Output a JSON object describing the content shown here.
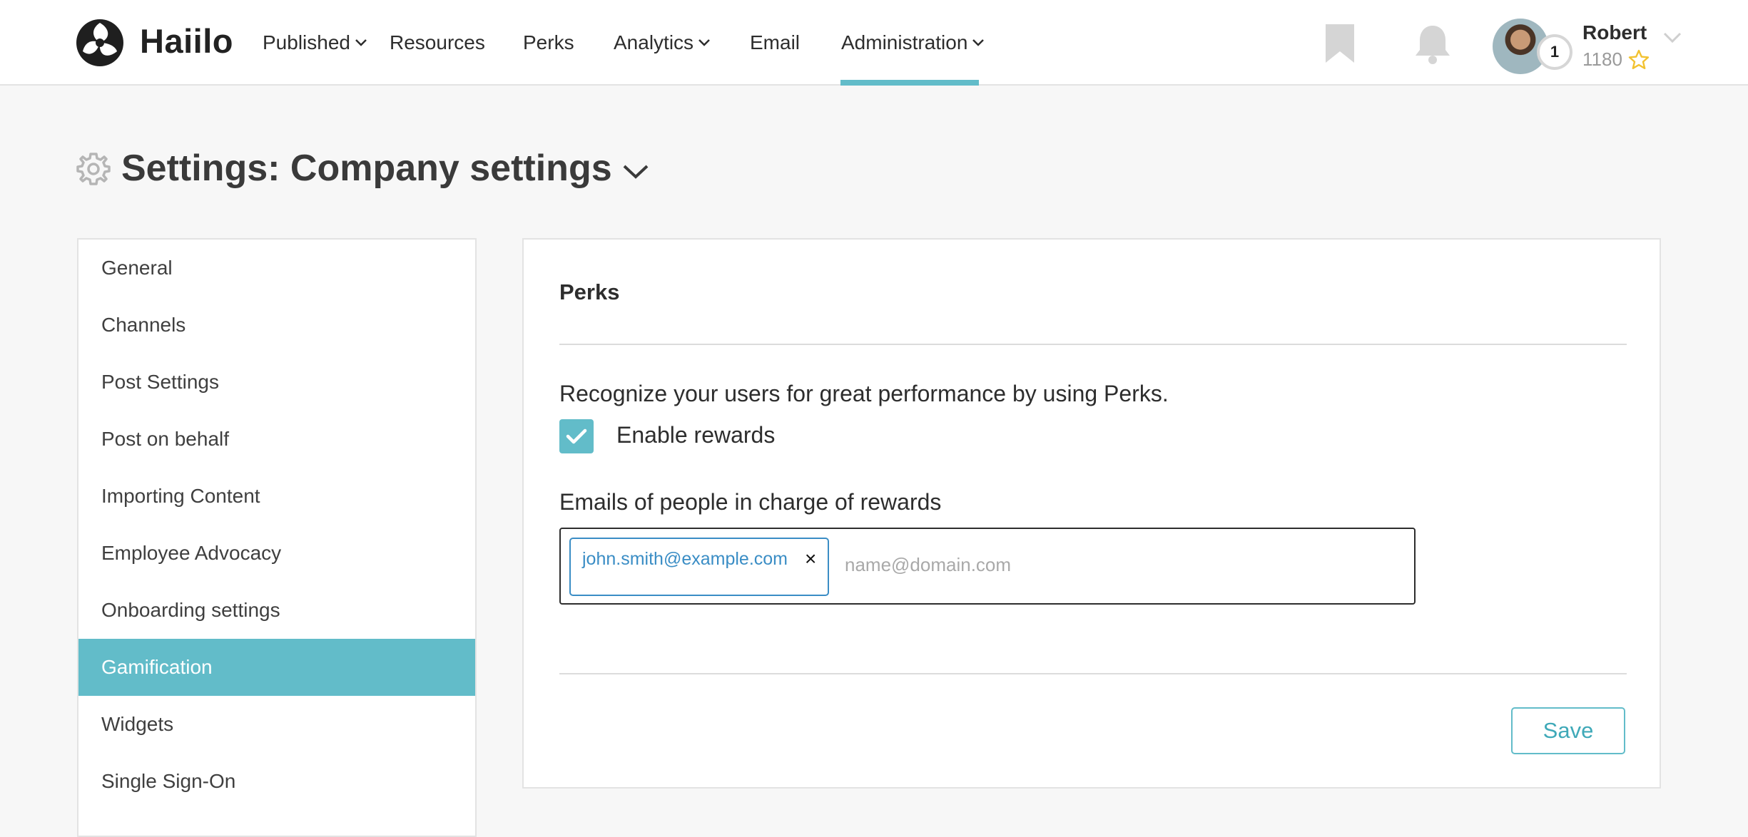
{
  "brand": {
    "name": "Haiilo",
    "logo_icon": "haiilo-logo-icon"
  },
  "nav": {
    "items": [
      {
        "label": "Published",
        "has_dropdown": true
      },
      {
        "label": "Resources",
        "has_dropdown": false
      },
      {
        "label": "Perks",
        "has_dropdown": false
      },
      {
        "label": "Analytics",
        "has_dropdown": true
      },
      {
        "label": "Email",
        "has_dropdown": false
      },
      {
        "label": "Administration",
        "has_dropdown": true,
        "active": true
      }
    ],
    "accent_color": "#62bcc9"
  },
  "user": {
    "name": "Robert",
    "points": "1180",
    "level": "1"
  },
  "page": {
    "title": "Settings: Company settings"
  },
  "sidebar": {
    "items": [
      {
        "label": "General"
      },
      {
        "label": "Channels"
      },
      {
        "label": "Post Settings"
      },
      {
        "label": "Post on behalf"
      },
      {
        "label": "Importing Content"
      },
      {
        "label": "Employee Advocacy"
      },
      {
        "label": "Onboarding settings"
      },
      {
        "label": "Gamification",
        "active": true
      },
      {
        "label": "Widgets"
      },
      {
        "label": "Single Sign-On"
      }
    ]
  },
  "perks": {
    "title": "Perks",
    "description": "Recognize your users for great performance by using Perks.",
    "enable_rewards_label": "Enable rewards",
    "enable_rewards_checked": true,
    "emails_label": "Emails of people in charge of rewards",
    "emails": [
      "john.smith@example.com"
    ],
    "email_placeholder": "name@domain.com",
    "save_label": "Save"
  }
}
